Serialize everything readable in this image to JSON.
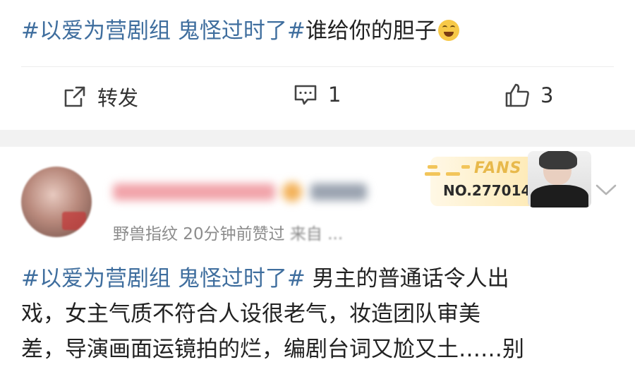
{
  "post": {
    "hashtag": "#以爱为营剧组 鬼怪过时了#",
    "text": "谁给你的胆子",
    "emoji": "laughing-tears-emoji"
  },
  "actions": {
    "repost_label": "转发",
    "comment_count": "1",
    "like_count": "3"
  },
  "comment": {
    "meta_time": "野兽指纹 20分钟前赞过",
    "meta_source": "来自 ...",
    "fans_badge": {
      "title": "FANS",
      "number": "NO.277014"
    },
    "hashtag": "#以爱为营剧组 鬼怪过时了#",
    "lines": [
      " 男主的普通话令人出",
      "戏，女主气质不符合人设很老气，妆造团队审美",
      "差，导演画面运镜拍的烂，编剧台词又尬又土……别"
    ]
  },
  "colors": {
    "hashtag": "#3f6e9e",
    "meta": "#8c8c8c",
    "gap": "#f2f2f2"
  }
}
